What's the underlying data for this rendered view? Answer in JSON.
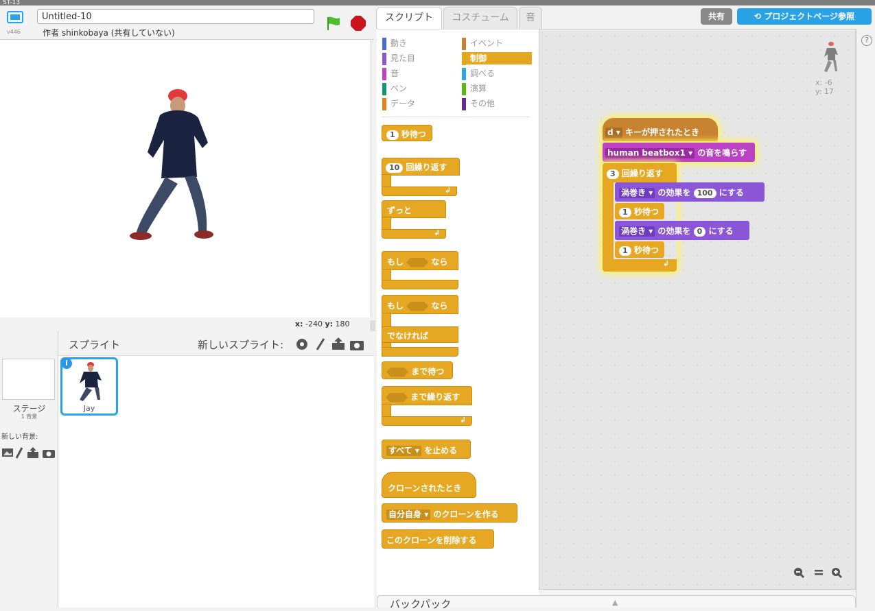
{
  "app": {
    "top_text": "ST-13"
  },
  "stage": {
    "version": "v446",
    "project_title": "Untitled-10",
    "author": "作者 shinkobaya (共有していない)",
    "coords": {
      "x_label": "x:",
      "x_value": "-240",
      "y_label": "y:",
      "y_value": "180"
    }
  },
  "sprites": {
    "title": "スプライト",
    "new_sprite_label": "新しいスプライト:",
    "stage_label": "ステージ",
    "stage_bg_count": "1 背景",
    "new_bg_label": "新しい背景:",
    "selected_sprite": {
      "name": "Jay",
      "info": "i"
    }
  },
  "tabs": [
    {
      "label": "スクリプト",
      "active": true
    },
    {
      "label": "コスチューム",
      "active": false
    },
    {
      "label": "音",
      "active": false
    }
  ],
  "header_buttons": {
    "share": "共有",
    "project_page": "プロジェクトページ参照"
  },
  "categories": [
    {
      "label": "動き",
      "color": "#4a6cd4"
    },
    {
      "label": "見た目",
      "color": "#8a55d7"
    },
    {
      "label": "音",
      "color": "#bb42c3"
    },
    {
      "label": "ペン",
      "color": "#0e9a6c"
    },
    {
      "label": "データ",
      "color": "#ee7d16"
    },
    {
      "label": "イベント",
      "color": "#c88330"
    },
    {
      "label": "制御",
      "color": "#e1a91a",
      "selected": true
    },
    {
      "label": "調べる",
      "color": "#2ca5e2"
    },
    {
      "label": "演算",
      "color": "#5cb712"
    },
    {
      "label": "その他",
      "color": "#632d99"
    }
  ],
  "palette_blocks": {
    "wait_num": "1",
    "wait_text": "秒待つ",
    "repeat_num": "10",
    "repeat_text": "回繰り返す",
    "forever": "ずっと",
    "if_text": "もし",
    "then_text": "なら",
    "if2_text": "もし",
    "then2_text": "なら",
    "else_text": "でなければ",
    "wait_until": "まで待つ",
    "repeat_until": "まで繰り返す",
    "stop_option": "すべて",
    "stop_text": "を止める",
    "clone_start": "クローンされたとき",
    "create_clone_option": "自分自身",
    "create_clone_text": "のクローンを作る",
    "delete_clone": "このクローンを削除する"
  },
  "script": {
    "hat_key": "d",
    "hat_text": "キーが押されたとき",
    "sound_name": "human beatbox1",
    "sound_text": "の音を鳴らす",
    "repeat_num": "3",
    "repeat_text": "回繰り返す",
    "effect1_name": "渦巻き",
    "effect1_mid": "の効果を",
    "effect1_value": "100",
    "effect1_end": "にする",
    "wait1_num": "1",
    "wait1_text": "秒待つ",
    "effect2_name": "渦巻き",
    "effect2_mid": "の効果を",
    "effect2_value": "0",
    "effect2_end": "にする",
    "wait2_num": "1",
    "wait2_text": "秒待つ"
  },
  "script_area": {
    "sprite_x": "x: -6",
    "sprite_y": "y: 17",
    "help": "?"
  },
  "backpack": {
    "label": "バックパック"
  },
  "colors": {
    "control": "#e6a822",
    "events": "#c88330",
    "sound": "#bb42c3",
    "looks": "#8a55d7",
    "accent": "#29a3e6"
  }
}
